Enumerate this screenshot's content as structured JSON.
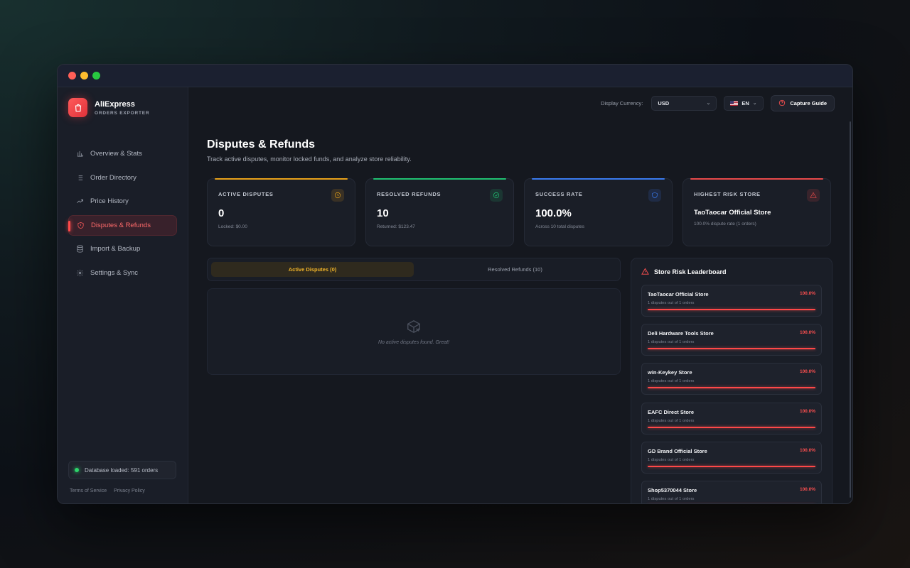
{
  "brand": {
    "name": "AliExpress",
    "subtitle": "ORDERS EXPORTER"
  },
  "nav": [
    {
      "label": "Overview & Stats",
      "icon": "bar-chart-icon",
      "active": false
    },
    {
      "label": "Order Directory",
      "icon": "list-icon",
      "active": false
    },
    {
      "label": "Price History",
      "icon": "trend-icon",
      "active": false
    },
    {
      "label": "Disputes & Refunds",
      "icon": "shield-alert-icon",
      "active": true
    },
    {
      "label": "Import & Backup",
      "icon": "database-icon",
      "active": false
    },
    {
      "label": "Settings & Sync",
      "icon": "gear-icon",
      "active": false
    }
  ],
  "db_status": "Database loaded: 591 orders",
  "footer": {
    "terms": "Terms of Service",
    "privacy": "Privacy Policy"
  },
  "topbar": {
    "currency_label": "Display Currency:",
    "currency_value": "USD",
    "language": "EN",
    "guide_label": "Capture Guide"
  },
  "page": {
    "title": "Disputes & Refunds",
    "subtitle": "Track active disputes, monitor locked funds, and analyze store reliability."
  },
  "stats": [
    {
      "label": "ACTIVE DISPUTES",
      "value": "0",
      "note": "Locked: $0.00",
      "color": "#e8a21a"
    },
    {
      "label": "RESOLVED REFUNDS",
      "value": "10",
      "note": "Returned: $123.47",
      "color": "#20c272"
    },
    {
      "label": "SUCCESS RATE",
      "value": "100.0%",
      "note": "Across 10 total disputes",
      "color": "#3a7bf0"
    },
    {
      "label": "HIGHEST RISK STORE",
      "value": "TaoTaocar Official Store",
      "note": "100.0% dispute rate (1 orders)",
      "color": "#e84a4a"
    }
  ],
  "tabs": [
    {
      "label": "Active Disputes (0)",
      "active": true
    },
    {
      "label": "Resolved Refunds (10)",
      "active": false
    }
  ],
  "empty_message": "No active disputes found. Great!",
  "leaderboard": {
    "title": "Store Risk Leaderboard",
    "items": [
      {
        "name": "TaoTaocar Official Store",
        "pct": "100.0%",
        "sub": "1 disputes out of 1 orders",
        "rate": 1.0
      },
      {
        "name": "Deli Hardware Tools Store",
        "pct": "100.0%",
        "sub": "1 disputes out of 1 orders",
        "rate": 1.0
      },
      {
        "name": "win-Keykey Store",
        "pct": "100.0%",
        "sub": "1 disputes out of 1 orders",
        "rate": 1.0
      },
      {
        "name": "EAFC Direct Store",
        "pct": "100.0%",
        "sub": "1 disputes out of 1 orders",
        "rate": 1.0
      },
      {
        "name": "GD Brand Official Store",
        "pct": "100.0%",
        "sub": "1 disputes out of 1 orders",
        "rate": 1.0
      },
      {
        "name": "Shop5370044 Store",
        "pct": "100.0%",
        "sub": "1 disputes out of 1 orders",
        "rate": 1.0
      }
    ]
  }
}
